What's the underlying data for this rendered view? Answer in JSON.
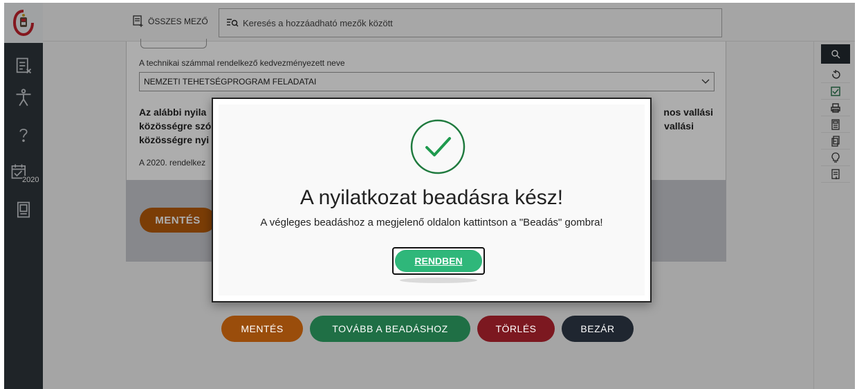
{
  "topbar": {
    "all_fields_label": "ÖSSZES MEZŐ",
    "search_placeholder": "Keresés a hozzáadható mezők között"
  },
  "left_nav": [
    {
      "icon": "form-icon"
    },
    {
      "icon": "accessibility-icon"
    },
    {
      "icon": "help-icon"
    },
    {
      "icon": "calendar-2020-icon",
      "label": "2020"
    },
    {
      "icon": "document-icon"
    }
  ],
  "right_tools": [
    "search-icon",
    "undo-icon",
    "check-icon",
    "print-icon",
    "calculator-icon",
    "copy-icon",
    "lightbulb-icon",
    "summary-icon"
  ],
  "form": {
    "beneficiary_label": "A technikai számmal rendelkező kedvezményezett neve",
    "beneficiary_value": "NEMZETI TEHETSÉGPROGRAM FELADATAI",
    "declaration_visible_left": "Az alábbi nyila",
    "declaration_right": "nos vallási",
    "declaration_line2_left": "közösségre szó",
    "declaration_line2_right": "vallási",
    "declaration_line3_left": "közösségre nyi",
    "year_text_left": "A 2020. rendelkez",
    "save_label": "MENTÉS"
  },
  "bottom_actions": {
    "save": "MENTÉS",
    "proceed": "TOVÁBB A BEADÁSHOZ",
    "delete": "TÖRLÉS",
    "close": "BEZÁR"
  },
  "modal": {
    "title": "A nyilatkozat beadásra kész!",
    "message": "A végleges beadáshoz a megjelenő oldalon kattintson a \"Beadás\" gombra!",
    "ok_label": "RENDBEN"
  },
  "colors": {
    "success_green": "#2fb77a",
    "save_orange": "#b55a0a",
    "delete_red": "#7c1820",
    "close_dark": "#1f2630"
  }
}
